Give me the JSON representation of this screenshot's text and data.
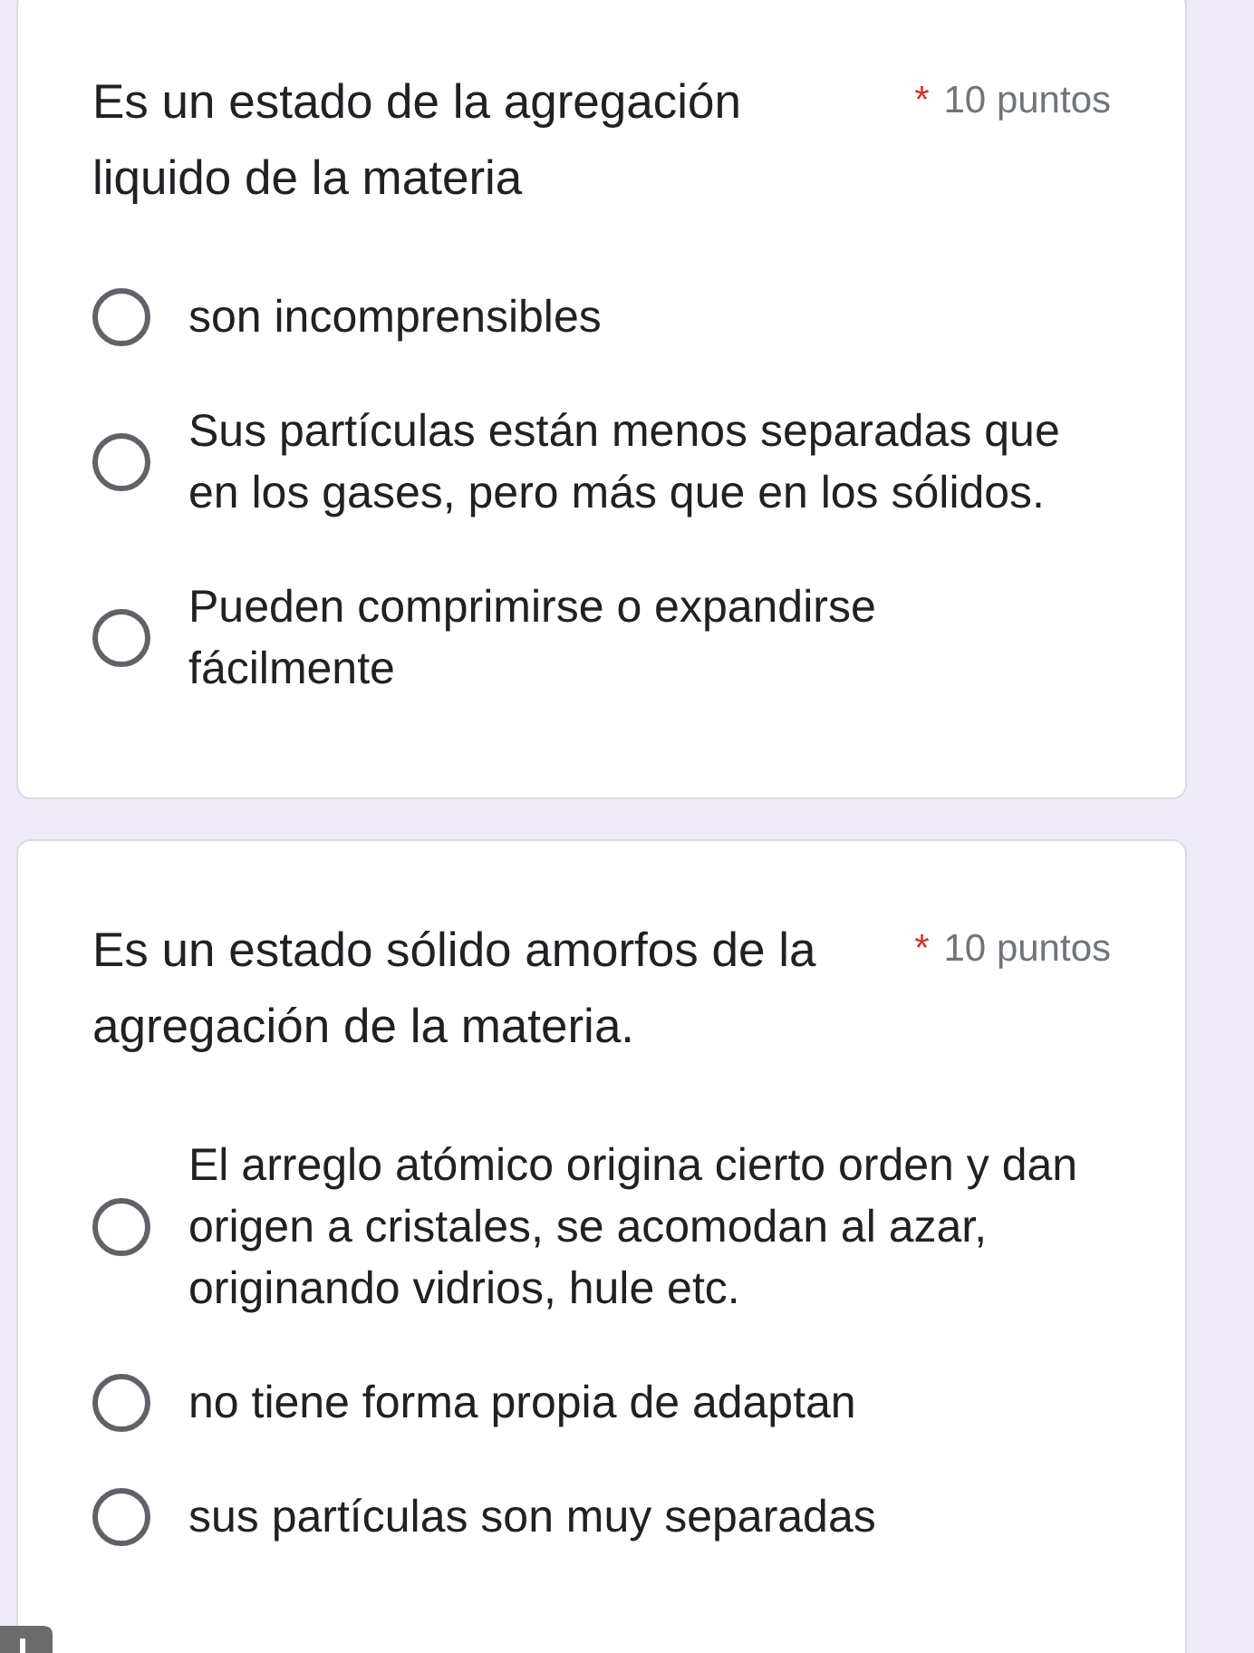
{
  "questions": [
    {
      "title": "Es un estado de la agregación liquido de la materia",
      "required_mark": "*",
      "points": "10 puntos",
      "options": [
        {
          "label": "son incomprensibles",
          "selected": false
        },
        {
          "label": "Sus partículas están menos separadas que en los gases, pero más que en los sólidos.",
          "selected": false
        },
        {
          "label": "Pueden comprimirse o expandirse fácilmente",
          "selected": false
        }
      ]
    },
    {
      "title": "Es un estado sólido amorfos de la agregación de la materia.",
      "required_mark": "*",
      "points": "10 puntos",
      "options": [
        {
          "label": "El arreglo atómico origina cierto orden y dan origen a cristales, se acomodan al azar, originando vidrios, hule etc.",
          "selected": false
        },
        {
          "label": "no tiene forma propia de adaptan",
          "selected": false
        },
        {
          "label": "sus partículas son muy separadas",
          "selected": false
        }
      ]
    }
  ]
}
